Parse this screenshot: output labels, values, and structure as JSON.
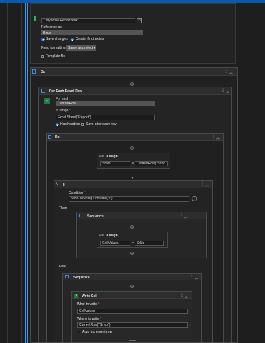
{
  "top_card": {
    "file_path": "\"Day Wise Report.xlsx\"",
    "reference_label": "Reference as",
    "reference_value": "Excel",
    "save_changes": "Save changes",
    "create_if_not_exists": "Create if not exists",
    "read_formatting_label": "Read formatting",
    "read_formatting_value": "Same as project",
    "template_file": "Template file"
  },
  "do_outer": {
    "title": "Do"
  },
  "for_each_row": {
    "title": "For Each Excel Row",
    "for_each_label": "For each",
    "for_each_value": "CurrentRow",
    "in_range_label": "In range",
    "in_range_value": "Excel.Sheet(\"Report\")",
    "has_headers": "Has headers",
    "save_after_each_row": "Save after each row"
  },
  "do_inner": {
    "title": "Do"
  },
  "assign1": {
    "title": "Assign",
    "left": "SrNo",
    "eq": "=",
    "right": "CurrentRow(\"Sr no"
  },
  "if_block": {
    "title": "If",
    "condition_label": "Condition",
    "condition_value": "SrNo.ToString.Contains(\"/\")",
    "then_label": "Then",
    "else_label": "Else"
  },
  "sequence_then": {
    "title": "Sequence"
  },
  "assign2": {
    "title": "Assign",
    "left": "CellValues",
    "eq": "=",
    "right": "SrNo"
  },
  "sequence_else": {
    "title": "Sequence"
  },
  "write_cell": {
    "title": "Write Cell",
    "what_label": "What to write",
    "what_value": "CellValues",
    "where_label": "Where to write",
    "where_value": "CurrentRow(\"Sr no\")",
    "auto_increment": "Auto increment row"
  },
  "icons": {
    "more": "⋮",
    "collapse": "︽",
    "plus": "+",
    "required": "*",
    "dropdown": "▾",
    "folder": "▭"
  }
}
